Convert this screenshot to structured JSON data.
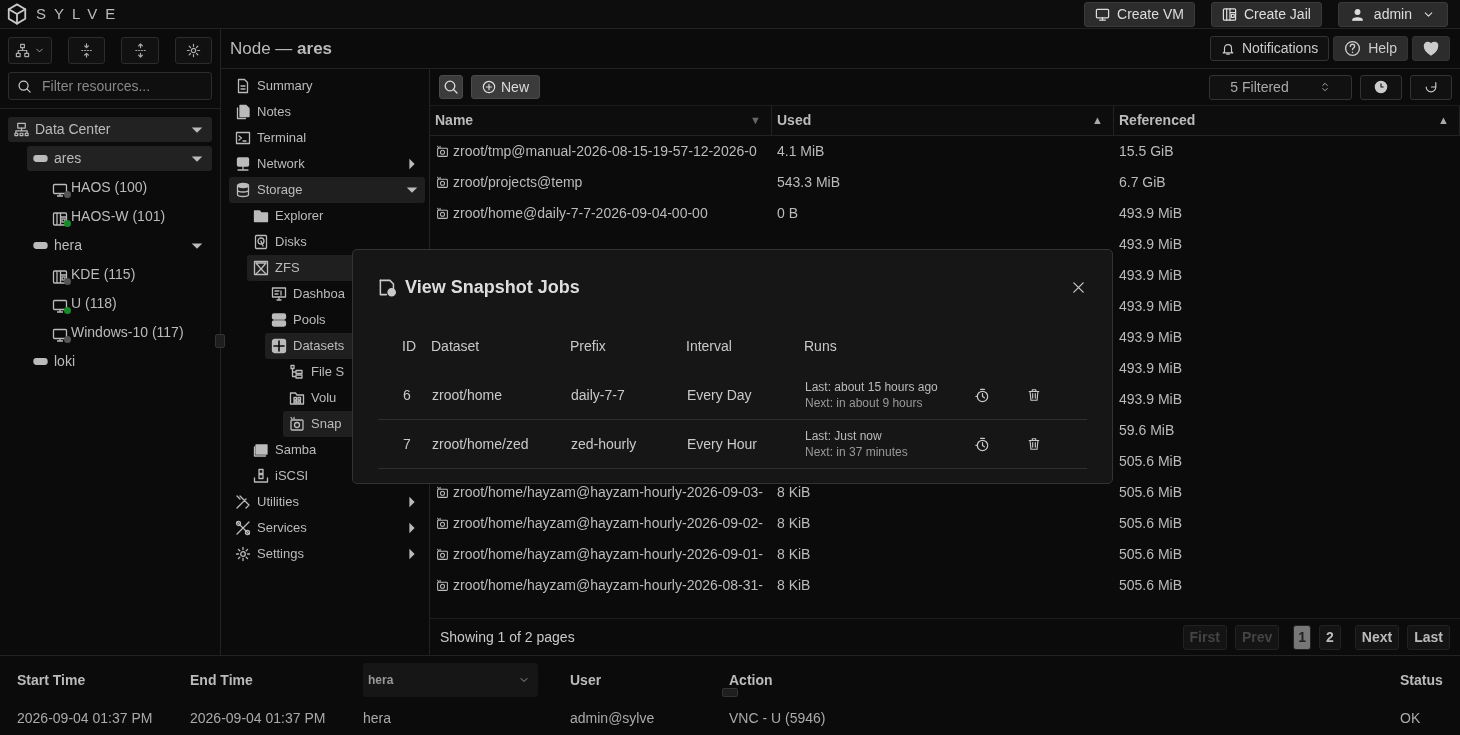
{
  "app": {
    "brand": "SYLVE",
    "buttons": [
      {
        "kind": "vm",
        "label": "Create VM"
      },
      {
        "kind": "jail",
        "label": "Create Jail"
      }
    ],
    "user": "admin"
  },
  "sidebar": {
    "search": {
      "placeholder": "Filter resources..."
    },
    "tree": [
      {
        "kind": "datacenter",
        "label": "Data Center",
        "selected": true,
        "expanded": true,
        "children": [
          {
            "kind": "node",
            "label": "ares",
            "selected": true,
            "expanded": true,
            "children": [
              {
                "kind": "vm",
                "label": "HAOS (100)",
                "selected": false,
                "running": false
              },
              {
                "kind": "jail",
                "label": "HAOS-W (101)",
                "selected": false,
                "running": true
              }
            ]
          },
          {
            "kind": "node",
            "label": "hera",
            "selected": false,
            "expanded": true,
            "children": [
              {
                "kind": "jail",
                "label": "KDE (115)",
                "selected": false,
                "running": false
              },
              {
                "kind": "vm",
                "label": "U (118)",
                "selected": false,
                "running": true
              },
              {
                "kind": "vm",
                "label": "Windows-10 (117)",
                "selected": false,
                "running": false
              }
            ]
          },
          {
            "kind": "node",
            "label": "loki",
            "selected": false
          }
        ]
      }
    ]
  },
  "header": {
    "title": "Node — **ares**",
    "buttons": [
      {
        "kind": "bell",
        "label": "Notifications"
      },
      {
        "kind": "help",
        "label": "Help"
      },
      {
        "kind": "heart"
      }
    ]
  },
  "nav": [
    {
      "label": "Summary",
      "selected": false
    },
    {
      "label": "Notes",
      "selected": false
    },
    {
      "label": "Terminal",
      "selected": false
    },
    {
      "label": "Network",
      "selected": false,
      "expanded": false
    },
    {
      "label": "Storage",
      "selected": true,
      "expanded": true,
      "children": [
        {
          "label": "Explorer",
          "selected": false
        },
        {
          "label": "Disks",
          "selected": false
        },
        {
          "label": "ZFS",
          "selected": true,
          "children": [
            {
              "label": "Dashboa",
              "selected": false
            },
            {
              "label": "Pools",
              "selected": false
            },
            {
              "label": "Datasets",
              "selected": true,
              "children": [
                {
                  "label": "File S",
                  "selected": false
                },
                {
                  "label": "Volu",
                  "selected": false
                },
                {
                  "label": "Snap",
                  "selected": true
                }
              ]
            }
          ]
        },
        {
          "label": "Samba",
          "selected": false
        },
        {
          "label": "iSCSI",
          "selected": false
        }
      ]
    },
    {
      "label": "Utilities",
      "selected": false,
      "expanded": false
    },
    {
      "label": "Services",
      "selected": false,
      "expanded": false
    },
    {
      "label": "Settings",
      "selected": false,
      "expanded": false
    }
  ],
  "toolbar": {
    "new_button": "New",
    "filter": "5 Filtered"
  },
  "table": {
    "columns": [
      {
        "label": "Name",
        "sort": "▼"
      },
      {
        "label": "Used",
        "sort": "▲"
      },
      {
        "label": "Referenced",
        "sort": "▲"
      }
    ],
    "rows": [
      {
        "name": "zroot/tmp@manual-2026-08-15-19-57-12-2026-0",
        "used": "4.1 MiB",
        "referenced": "15.5 GiB"
      },
      {
        "name": "zroot/projects@temp",
        "used": "543.3 MiB",
        "referenced": "6.7 GiB"
      },
      {
        "name": "zroot/home@daily-7-7-2026-09-04-00-00",
        "used": "0 B",
        "referenced": "493.9 MiB"
      },
      {
        "referenced": "493.9 MiB"
      },
      {
        "referenced": "493.9 MiB"
      },
      {
        "referenced": "493.9 MiB"
      },
      {
        "referenced": "493.9 MiB"
      },
      {
        "referenced": "493.9 MiB"
      },
      {
        "referenced": "493.9 MiB"
      },
      {
        "referenced": "59.6 MiB"
      },
      {
        "referenced": "505.6 MiB"
      },
      {
        "name": "zroot/home/hayzam@hayzam-hourly-2026-09-03-",
        "used": "8 KiB",
        "referenced": "505.6 MiB"
      },
      {
        "name": "zroot/home/hayzam@hayzam-hourly-2026-09-02-",
        "used": "8 KiB",
        "referenced": "505.6 MiB"
      },
      {
        "name": "zroot/home/hayzam@hayzam-hourly-2026-09-01-",
        "used": "8 KiB",
        "referenced": "505.6 MiB"
      },
      {
        "name": "zroot/home/hayzam@hayzam-hourly-2026-08-31-",
        "used": "8 KiB",
        "referenced": "505.6 MiB"
      }
    ],
    "footer": "Showing 1 of 2 pages",
    "pagination": [
      {
        "label": "First",
        "disabled": true,
        "selected": false
      },
      {
        "label": "Prev",
        "disabled": true,
        "selected": false
      },
      {
        "label": "1",
        "disabled": false,
        "selected": true
      },
      {
        "label": "2",
        "disabled": false,
        "selected": false
      },
      {
        "label": "Next",
        "disabled": false,
        "selected": false
      },
      {
        "label": "Last",
        "disabled": false,
        "selected": false
      }
    ]
  },
  "modal": {
    "title": "View Snapshot Jobs",
    "columns": [
      "ID",
      "Dataset",
      "Prefix",
      "Interval",
      "Runs"
    ],
    "rows": [
      {
        "id": "6",
        "dataset": "zroot/home",
        "prefix": "daily-7-7",
        "interval": "Every Day",
        "last": "Last: about 15 hours ago",
        "next": "Next: in about 9 hours"
      },
      {
        "id": "7",
        "dataset": "zroot/home/zed",
        "prefix": "zed-hourly",
        "interval": "Every Hour",
        "last": "Last: Just now",
        "next": "Next: in 37 minutes"
      }
    ]
  },
  "log": {
    "columns": [
      "Start Time",
      "End Time",
      "User",
      "Action",
      "Status"
    ],
    "filter": {
      "value": "hera"
    },
    "rows": [
      {
        "start": "2026-09-04 01:37 PM",
        "end": "2026-09-04 01:37 PM",
        "node": "hera",
        "user": "admin@sylve",
        "action": "VNC - U (5946)",
        "status": "OK"
      }
    ]
  }
}
